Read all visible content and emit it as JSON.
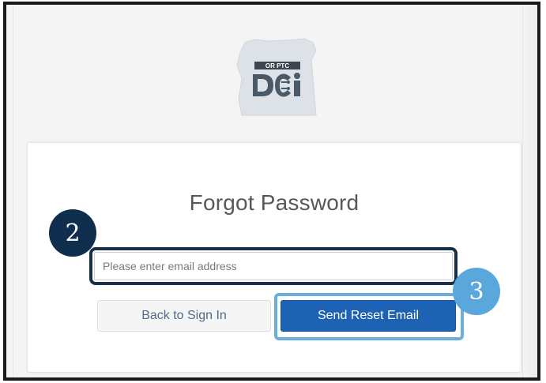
{
  "logo": {
    "badge_text": "OR PTC",
    "wordmark": "DCI"
  },
  "form": {
    "title": "Forgot Password",
    "email_placeholder": "Please enter email address",
    "email_value": "",
    "back_label": "Back to Sign In",
    "send_label": "Send Reset Email"
  },
  "callouts": {
    "step_email": "2",
    "step_send": "3"
  },
  "colors": {
    "primary_button": "#1d62b3",
    "callout_dark": "#0f2e4e",
    "callout_light": "#5aa7dc"
  }
}
